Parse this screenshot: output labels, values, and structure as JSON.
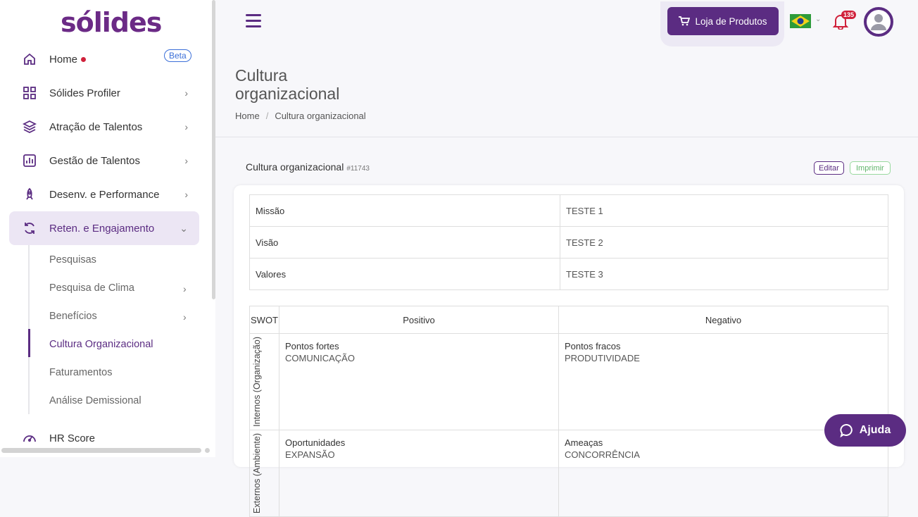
{
  "brand": {
    "logo": "sólides"
  },
  "sidebar": {
    "items": [
      {
        "label": "Home",
        "badge": "Beta"
      },
      {
        "label": "Sólides Profiler"
      },
      {
        "label": "Atração de Talentos"
      },
      {
        "label": "Gestão de Talentos"
      },
      {
        "label": "Desenv. e Performance"
      },
      {
        "label": "Reten. e Engajamento"
      },
      {
        "label": "HR Score"
      }
    ],
    "sub_items": [
      {
        "label": "Pesquisas"
      },
      {
        "label": "Pesquisa de Clima"
      },
      {
        "label": "Benefícios"
      },
      {
        "label": "Cultura Organizacional"
      },
      {
        "label": "Faturamentos"
      },
      {
        "label": "Análise Demissional"
      }
    ]
  },
  "header": {
    "shop_label": "Loja de Produtos",
    "notifications_count": "135"
  },
  "page": {
    "title": "Cultura organizacional",
    "breadcrumb": [
      "Home",
      "Cultura organizacional"
    ]
  },
  "card": {
    "title": "Cultura organizacional",
    "id": "#11743",
    "edit_label": "Editar",
    "print_label": "Imprimir",
    "values": [
      {
        "key": "Missão",
        "value": "TESTE 1"
      },
      {
        "key": "Visão",
        "value": "TESTE 2"
      },
      {
        "key": "Valores",
        "value": "TESTE 3"
      }
    ],
    "swot": {
      "header": [
        "SWOT",
        "Positivo",
        "Negativo"
      ],
      "rows": [
        {
          "label": "Internos (Organização)",
          "cells": [
            {
              "title": "Pontos fortes",
              "value": "COMUNICAÇÃO"
            },
            {
              "title": "Pontos fracos",
              "value": "PRODUTIVIDADE"
            }
          ]
        },
        {
          "label": "Externos (Ambiente)",
          "cells": [
            {
              "title": "Oportunidades",
              "value": "EXPANSÃO"
            },
            {
              "title": "Ameaças",
              "value": "CONCORRÊNCIA"
            }
          ]
        }
      ]
    }
  },
  "help": {
    "label": "Ajuda"
  },
  "colors": {
    "primary": "#5b2c82",
    "active_bg": "#ece6f4",
    "alert": "#d0213b"
  }
}
